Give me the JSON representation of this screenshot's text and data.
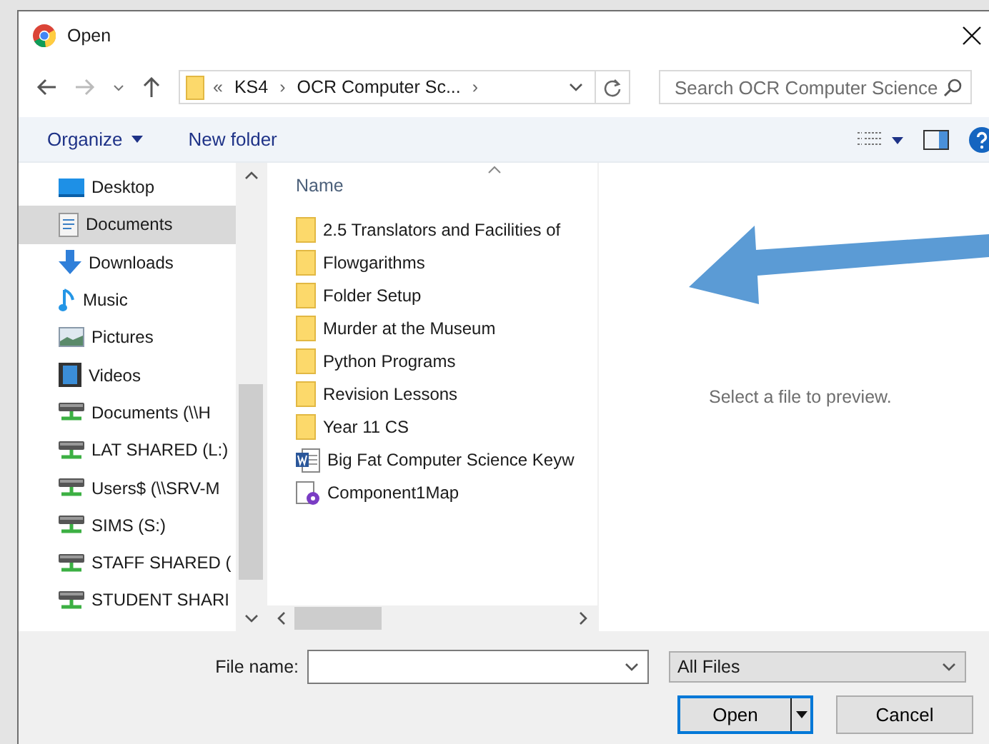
{
  "window": {
    "title": "Open"
  },
  "address": {
    "path": [
      "«",
      "KS4",
      "›",
      "OCR Computer Sc...",
      "›"
    ],
    "search_placeholder": "Search OCR Computer Science"
  },
  "toolbar": {
    "organize": "Organize",
    "new_folder": "New folder"
  },
  "nav": [
    {
      "label": "Desktop",
      "kind": "desktop",
      "selected": false
    },
    {
      "label": "Documents",
      "kind": "documents",
      "selected": true
    },
    {
      "label": "Downloads",
      "kind": "downloads",
      "selected": false
    },
    {
      "label": "Music",
      "kind": "music",
      "selected": false
    },
    {
      "label": "Pictures",
      "kind": "pictures",
      "selected": false
    },
    {
      "label": "Videos",
      "kind": "videos",
      "selected": false
    },
    {
      "label": "Documents (\\\\H",
      "kind": "drive",
      "selected": false
    },
    {
      "label": "LAT SHARED (L:)",
      "kind": "drive",
      "selected": false
    },
    {
      "label": "Users$ (\\\\SRV-M",
      "kind": "drive",
      "selected": false
    },
    {
      "label": "SIMS (S:)",
      "kind": "drive",
      "selected": false
    },
    {
      "label": "STAFF SHARED (",
      "kind": "drive",
      "selected": false
    },
    {
      "label": "STUDENT SHARI",
      "kind": "drive",
      "selected": false
    }
  ],
  "files": {
    "column": "Name",
    "items": [
      {
        "name": "2.5 Translators and Facilities of",
        "kind": "folder"
      },
      {
        "name": "Flowgarithms",
        "kind": "folder"
      },
      {
        "name": "Folder Setup",
        "kind": "folder"
      },
      {
        "name": "Murder at the Museum",
        "kind": "folder"
      },
      {
        "name": "Python Programs",
        "kind": "folder"
      },
      {
        "name": "Revision Lessons",
        "kind": "folder"
      },
      {
        "name": "Year 11 CS",
        "kind": "folder"
      },
      {
        "name": "Big Fat Computer Science Keyw",
        "kind": "word"
      },
      {
        "name": "Component1Map",
        "kind": "map"
      }
    ]
  },
  "preview": {
    "message": "Select a file to preview."
  },
  "annotation": {
    "kind": "arrow"
  },
  "bottom": {
    "file_name_label": "File name:",
    "filter": "All Files",
    "open": "Open",
    "cancel": "Cancel"
  }
}
